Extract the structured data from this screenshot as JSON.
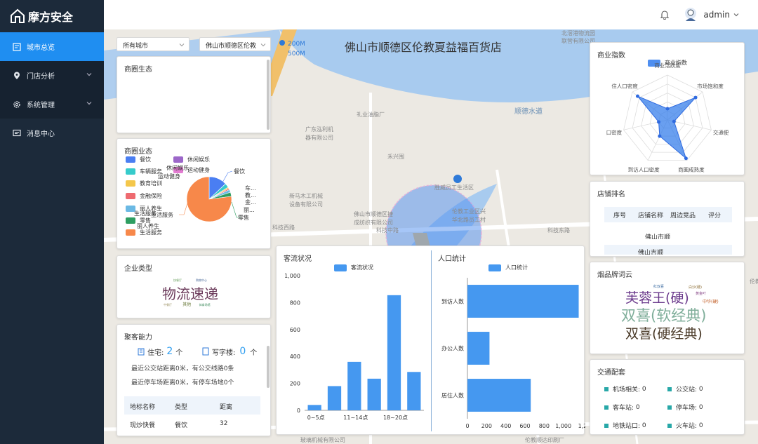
{
  "app": {
    "logo_text": "摩方安全"
  },
  "sidebar": {
    "items": [
      {
        "label": "城市总览",
        "icon": "overview-icon",
        "active": true
      },
      {
        "label": "门店分析",
        "icon": "location-pin-icon"
      },
      {
        "label": "系统管理",
        "icon": "gear-icon"
      },
      {
        "label": "消息中心",
        "icon": "message-icon"
      }
    ]
  },
  "topbar": {
    "user": "admin",
    "bell_icon": "bell-icon",
    "avatar_icon": "avatar-icon"
  },
  "filters": {
    "city": "所有城市",
    "store": "佛山市顺德区伦教"
  },
  "map": {
    "title": "佛山市顺德区伦教夏益福百货店",
    "scale": [
      "200M",
      "500M"
    ],
    "labels": [
      {
        "t": "北滘港物流园"
      },
      {
        "t": "联营有限公司"
      },
      {
        "t": "顺德水道"
      },
      {
        "t": "礼业油脂厂"
      },
      {
        "t": "广东泓利机"
      },
      {
        "t": "器有限公司"
      },
      {
        "t": "禾兴围"
      },
      {
        "t": "胜威员工生活区"
      },
      {
        "t": "新马木工机械"
      },
      {
        "t": "设备有限公司"
      },
      {
        "t": "佛山市顺德区捷"
      },
      {
        "t": "成纺织有限公司"
      },
      {
        "t": "伦教工业区兴"
      },
      {
        "t": "华北路员工村"
      },
      {
        "t": "科技中路"
      },
      {
        "t": "科技东路"
      },
      {
        "t": "科技西路"
      },
      {
        "t": "伦教顺达印刷厂"
      },
      {
        "t": "玻璃机械有限公司"
      },
      {
        "t": "伦教"
      }
    ]
  },
  "panels": {
    "business_ecology": {
      "title": "商圈生态"
    },
    "business_format": {
      "title": "商圈业态",
      "legend": [
        {
          "label": "餐饮",
          "color": "#4a7ef2"
        },
        {
          "label": "车辆服务",
          "color": "#36cbcb"
        },
        {
          "label": "教育培训",
          "color": "#f4c74b"
        },
        {
          "label": "金融保险",
          "color": "#ee6a70"
        },
        {
          "label": "丽人养生",
          "color": "#6bb9e4"
        },
        {
          "label": "零售",
          "color": "#2e9e61"
        },
        {
          "label": "生活服务",
          "color": "#f7884a"
        },
        {
          "label": "休闲娱乐",
          "color": "#9c67c9"
        },
        {
          "label": "运动健身",
          "color": "#e37cd2"
        }
      ],
      "overlap_labels": [
        "休闲娱乐",
        "运动健身",
        "生活服务",
        "丽人养生"
      ],
      "slice_labels": [
        "餐饮",
        "车...",
        "教...",
        "金...",
        "丽...",
        "零售",
        "生活服务"
      ],
      "slices": [
        {
          "label": "餐饮",
          "value": 13
        },
        {
          "label": "车辆服务",
          "value": 3
        },
        {
          "label": "教育培训",
          "value": 1
        },
        {
          "label": "金融保险",
          "value": 1
        },
        {
          "label": "丽人养生",
          "value": 2
        },
        {
          "label": "零售",
          "value": 3
        },
        {
          "label": "生活服务",
          "value": 77
        }
      ]
    },
    "enterprise_type": {
      "title": "企业类型",
      "words": [
        {
          "t": "物流速递",
          "size": 20
        },
        {
          "t": "快餐厅",
          "size": 6
        },
        {
          "t": "购物中心",
          "size": 4
        },
        {
          "t": "中餐厅",
          "size": 4
        },
        {
          "t": "其他",
          "size": 4
        },
        {
          "t": "体育场馆",
          "size": 4
        },
        {
          "t": "休闲广场",
          "size": 4
        }
      ]
    },
    "gathering": {
      "title": "聚客能力",
      "residential_label": "住宅:",
      "residential_value": "2",
      "residential_unit": "个",
      "office_label": "写字楼:",
      "office_value": "0",
      "office_unit": "个",
      "bus_text": "最近公交站距离0米，有公交线路0条",
      "parking_text": "最近停车场距离0米，有停车场地0个",
      "columns": [
        "地标名称",
        "类型",
        "距离"
      ],
      "rows": [
        [
          "现炒快餐",
          "餐饮",
          "32"
        ]
      ]
    },
    "commerce_index": {
      "title": "商业指数",
      "legend": "商业指数",
      "axes": [
        "商业活跃度",
        "市场饱和度",
        "交通便利度",
        "商圈成熟度",
        "到访人口密度",
        "人口密度",
        "住人口密度"
      ],
      "axis_labels_display": [
        "商业活跃度",
        "市场饱和度",
        "交通便",
        "商圈成熟度",
        "到访人口密度",
        "口密度",
        "住人口密度"
      ],
      "values": [
        0.25,
        0.8,
        0.15,
        0.95,
        0.4,
        0.2,
        0.85
      ]
    },
    "store_rank": {
      "title": "店铺排名",
      "columns": [
        "序号",
        "店铺名称",
        "周边竞品",
        "评分"
      ],
      "partial_rows": [
        "佛山市顺",
        "佛山吉顺"
      ]
    },
    "cigarette": {
      "title": "烟品牌词云",
      "words": [
        {
          "t": "芙蓉王(硬)",
          "color": "#6b3a8c"
        },
        {
          "t": "双喜(软经典)",
          "color": "#7fae9a"
        },
        {
          "t": "双喜(硬经典)",
          "color": "#4a3a28"
        },
        {
          "t": "中华(硬)",
          "color": "#c05a20"
        },
        {
          "t": "红双喜",
          "color": "#3a6aa0"
        },
        {
          "t": "白沙(硬)",
          "color": "#8a6a30"
        },
        {
          "t": "黄金叶",
          "color": "#8a4a8a"
        }
      ]
    },
    "traffic": {
      "title": "交通配套",
      "items": [
        {
          "label": "机场相关:",
          "value": "0"
        },
        {
          "label": "公交站:",
          "value": "0"
        },
        {
          "label": "客车站:",
          "value": "0"
        },
        {
          "label": "停车场:",
          "value": "0"
        },
        {
          "label": "地铁站口:",
          "value": "0"
        },
        {
          "label": "火车站:",
          "value": "0"
        }
      ]
    },
    "customer_flow": {
      "title": "客流状况",
      "legend": "客流状况"
    },
    "population": {
      "title": "人口统计",
      "legend": "人口统计"
    }
  },
  "chart_data": [
    {
      "type": "bar",
      "title": "客流状况",
      "series": [
        {
          "name": "客流状况",
          "values": [
            40,
            180,
            360,
            235,
            855,
            285
          ]
        }
      ],
      "categories": [
        "0~5点",
        "6~10点",
        "11~14点",
        "15~17点",
        "18~20点",
        "21~24点"
      ],
      "tick_labels": [
        "0~5点",
        "11~14点",
        "18~20点"
      ],
      "yticks": [
        0,
        200,
        400,
        600,
        800,
        1000
      ],
      "ytick_labels": [
        "0",
        "200",
        "400",
        "600",
        "800",
        "1,000"
      ],
      "ylim": [
        0,
        1000
      ],
      "color": "#4598f0"
    },
    {
      "type": "bar",
      "orientation": "horizontal",
      "title": "人口统计",
      "series": [
        {
          "name": "人口统计",
          "values": [
            1160,
            230,
            660
          ]
        }
      ],
      "categories": [
        "到访人数",
        "办公人数",
        "居住人数"
      ],
      "xticks": [
        0,
        200,
        400,
        600,
        800,
        1000,
        1200
      ],
      "xtick_labels": [
        "0",
        "200",
        "400",
        "600",
        "800",
        "1,000",
        "1,2"
      ],
      "xlim": [
        0,
        1200
      ],
      "color": "#4598f0"
    }
  ]
}
